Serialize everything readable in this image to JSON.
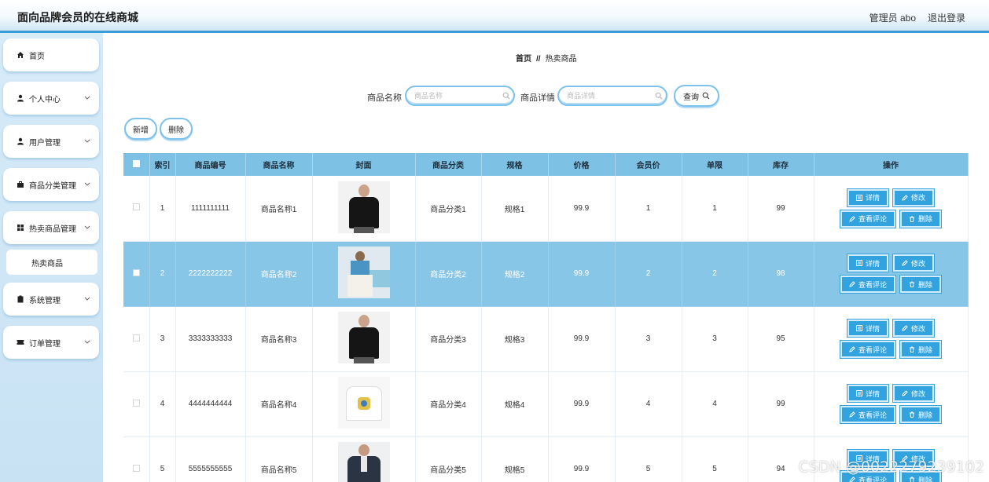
{
  "header": {
    "title": "面向品牌会员的在线商城",
    "admin_label": "管理员 abo",
    "logout_label": "退出登录"
  },
  "sidebar": {
    "items": [
      {
        "label": "首页",
        "icon": "home-icon"
      },
      {
        "label": "个人中心",
        "icon": "user-icon"
      },
      {
        "label": "用户管理",
        "icon": "user-icon"
      },
      {
        "label": "商品分类管理",
        "icon": "briefcase-icon"
      },
      {
        "label": "热卖商品管理",
        "icon": "grid-icon"
      },
      {
        "label": "系统管理",
        "icon": "clipboard-icon"
      },
      {
        "label": "订单管理",
        "icon": "ticket-icon"
      }
    ],
    "submenu": {
      "label": "热卖商品"
    }
  },
  "breadcrumb": {
    "home": "首页",
    "separator": "//",
    "current": "热卖商品"
  },
  "search": {
    "name_label": "商品名称",
    "name_placeholder": "商品名称",
    "detail_label": "商品详情",
    "detail_placeholder": "商品详情",
    "query_button": "查询"
  },
  "actions": {
    "add": "新增",
    "delete": "删除"
  },
  "table": {
    "headers": [
      "索引",
      "商品编号",
      "商品名称",
      "封面",
      "商品分类",
      "规格",
      "价格",
      "会员价",
      "单限",
      "库存",
      "操作"
    ],
    "row_buttons": {
      "detail": "详情",
      "edit": "修改",
      "review": "查看评论",
      "delete": "删除"
    },
    "rows": [
      {
        "index": "1",
        "code": "1111111111",
        "name": "商品名称1",
        "image": "black-tshirt-man",
        "category": "商品分类1",
        "spec": "规格1",
        "price": "99.9",
        "member_price": "1",
        "limit": "1",
        "stock": "99"
      },
      {
        "index": "2",
        "code": "2222222222",
        "name": "商品名称2",
        "image": "woman-white-dress",
        "category": "商品分类2",
        "spec": "规格2",
        "price": "99.9",
        "member_price": "2",
        "limit": "2",
        "stock": "98"
      },
      {
        "index": "3",
        "code": "3333333333",
        "name": "商品名称3",
        "image": "black-tshirt-man",
        "category": "商品分类3",
        "spec": "规格3",
        "price": "99.9",
        "member_price": "3",
        "limit": "3",
        "stock": "95"
      },
      {
        "index": "4",
        "code": "4444444444",
        "name": "商品名称4",
        "image": "white-tshirt-print",
        "category": "商品分类4",
        "spec": "规格4",
        "price": "99.9",
        "member_price": "4",
        "limit": "4",
        "stock": "99"
      },
      {
        "index": "5",
        "code": "5555555555",
        "name": "商品名称5",
        "image": "man-dark-jacket",
        "category": "商品分类5",
        "spec": "规格5",
        "price": "99.9",
        "member_price": "5",
        "limit": "5",
        "stock": "94"
      }
    ],
    "selected_row": 2
  },
  "colors": {
    "accent": "#33a3df",
    "header_bg": "#7dc1e4",
    "selected_row": "#88c6e7",
    "border": "#7cc2ec"
  },
  "watermark": "CSDN @0022279239102"
}
